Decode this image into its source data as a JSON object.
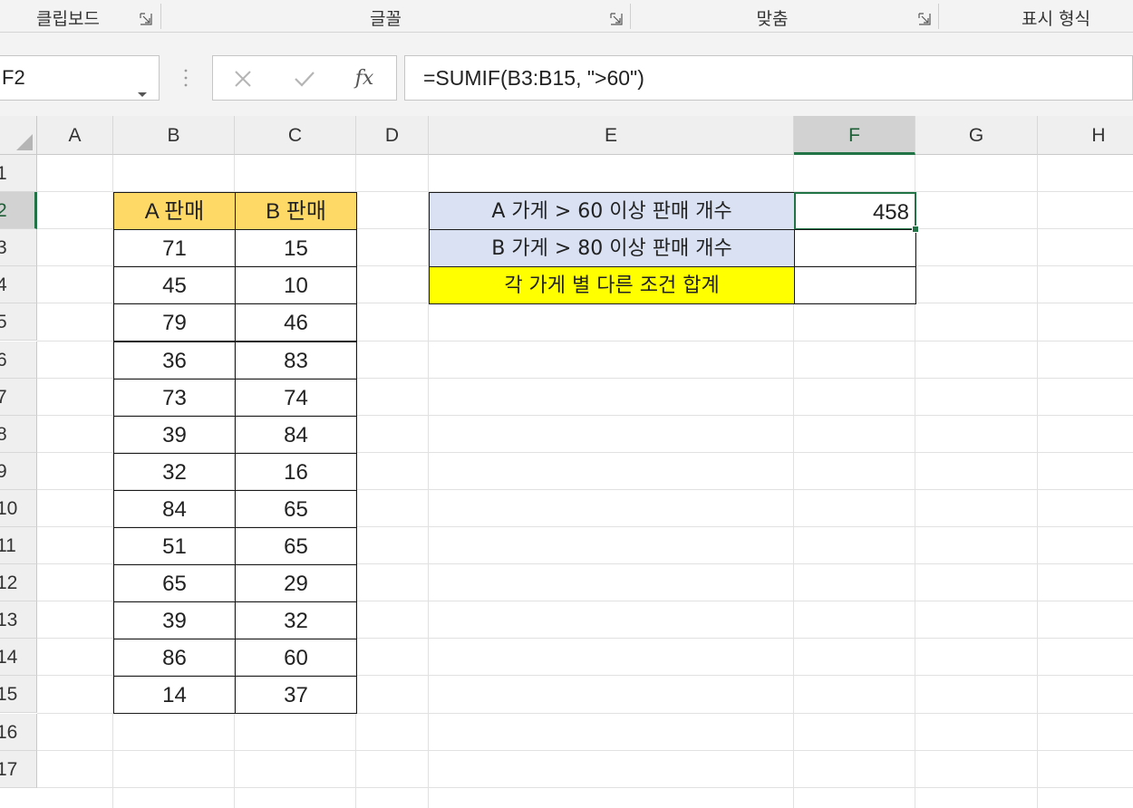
{
  "ribbon": {
    "groups": [
      "클립보드",
      "글꼴",
      "맞춤",
      "표시 형식"
    ]
  },
  "formula_bar": {
    "name_box": "F2",
    "cancel_icon": "x-icon",
    "enter_icon": "check-icon",
    "fx_label": "fx",
    "formula": "=SUMIF(B3:B15, \">60\")"
  },
  "columns": [
    "A",
    "B",
    "C",
    "D",
    "E",
    "F",
    "G",
    "H"
  ],
  "rows": [
    "1",
    "2",
    "3",
    "4",
    "5",
    "6",
    "7",
    "8",
    "9",
    "10",
    "11",
    "12",
    "13",
    "14",
    "15",
    "16",
    "17"
  ],
  "sales_table": {
    "headers": [
      "A 판매",
      "B 판매"
    ],
    "rows": [
      [
        "71",
        "15"
      ],
      [
        "45",
        "10"
      ],
      [
        "79",
        "46"
      ],
      [
        "36",
        "83"
      ],
      [
        "73",
        "74"
      ],
      [
        "39",
        "84"
      ],
      [
        "32",
        "16"
      ],
      [
        "84",
        "65"
      ],
      [
        "51",
        "65"
      ],
      [
        "65",
        "29"
      ],
      [
        "39",
        "32"
      ],
      [
        "86",
        "60"
      ],
      [
        "14",
        "37"
      ]
    ]
  },
  "summary": {
    "labels": [
      "A 가게 > 60 이상 판매 개수",
      "B 가게 > 80 이상 판매 개수",
      "각 가게 별 다른 조건 합계"
    ],
    "values": [
      "458",
      "",
      ""
    ]
  },
  "colors": {
    "accent": "#217346",
    "header_orange": "#ffd966",
    "label_blue": "#d9e1f2",
    "label_yellow": "#ffff00"
  }
}
